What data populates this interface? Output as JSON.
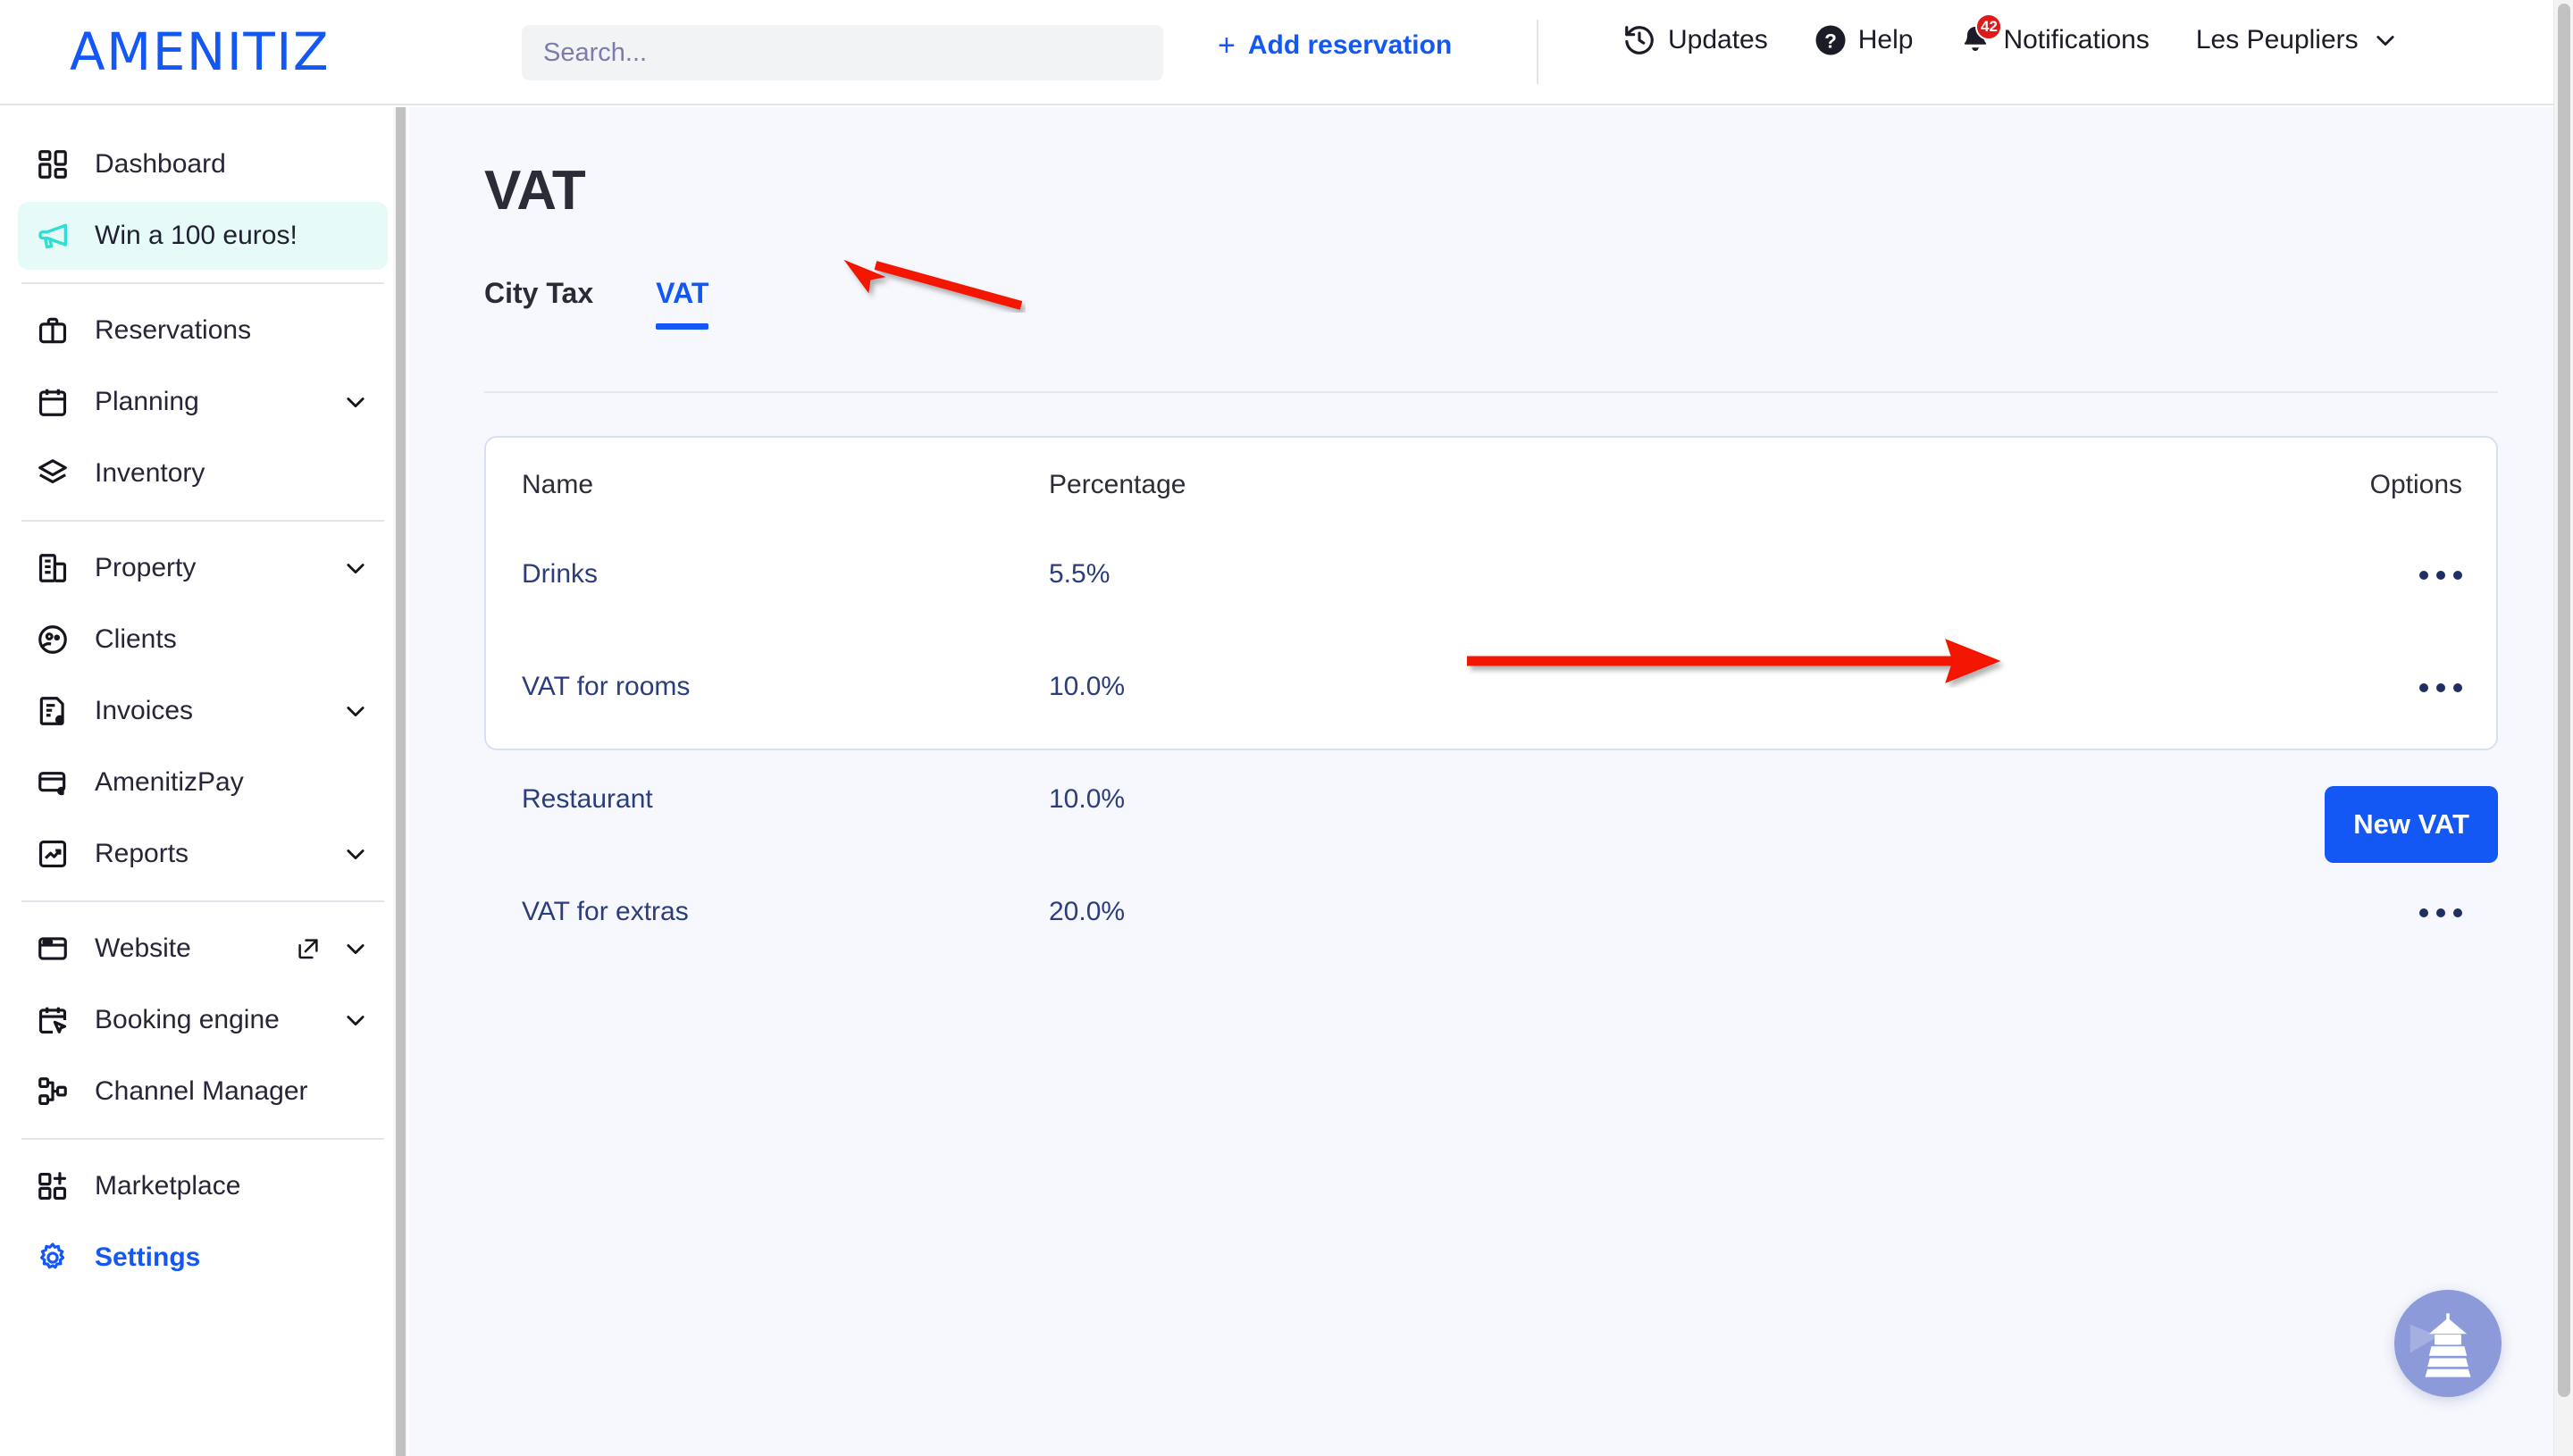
{
  "header": {
    "brand": "AMENITIZ",
    "search_placeholder": "Search...",
    "add_reservation": "Add reservation",
    "add_plus": "+",
    "updates": "Updates",
    "help": "Help",
    "notifications": "Notifications",
    "notification_count": "42",
    "property_name": "Les Peupliers",
    "chevron": "⌄"
  },
  "sidebar": {
    "items": [
      {
        "label": "Dashboard",
        "icon": "dashboard-icon",
        "chevron": false,
        "external": false
      },
      {
        "label": "Win a 100 euros!",
        "icon": "megaphone-icon",
        "chevron": false,
        "external": false
      },
      {
        "label": "Reservations",
        "icon": "briefcase-icon",
        "chevron": false,
        "external": false
      },
      {
        "label": "Planning",
        "icon": "calendar-icon",
        "chevron": true,
        "external": false
      },
      {
        "label": "Inventory",
        "icon": "layers-icon",
        "chevron": false,
        "external": false
      },
      {
        "label": "Property",
        "icon": "building-icon",
        "chevron": true,
        "external": false
      },
      {
        "label": "Clients",
        "icon": "clients-icon",
        "chevron": false,
        "external": false
      },
      {
        "label": "Invoices",
        "icon": "invoice-euro-icon",
        "chevron": true,
        "external": false
      },
      {
        "label": "AmenitizPay",
        "icon": "card-euro-icon",
        "chevron": false,
        "external": false
      },
      {
        "label": "Reports",
        "icon": "chart-up-icon",
        "chevron": true,
        "external": false
      },
      {
        "label": "Website",
        "icon": "browser-icon",
        "chevron": true,
        "external": true
      },
      {
        "label": "Booking engine",
        "icon": "calendar-click-icon",
        "chevron": true,
        "external": false
      },
      {
        "label": "Channel Manager",
        "icon": "nodes-icon",
        "chevron": false,
        "external": false
      },
      {
        "label": "Marketplace",
        "icon": "grid-plus-icon",
        "chevron": false,
        "external": false
      },
      {
        "label": "Settings",
        "icon": "gear-icon",
        "chevron": false,
        "external": false
      }
    ]
  },
  "main": {
    "title": "VAT",
    "tabs": [
      {
        "label": "City Tax",
        "active": false
      },
      {
        "label": "VAT",
        "active": true
      }
    ],
    "table": {
      "columns": [
        "Name",
        "Percentage",
        "Options"
      ],
      "rows": [
        {
          "name": "Drinks",
          "percentage": "5.5%"
        },
        {
          "name": "VAT for rooms",
          "percentage": "10.0%"
        },
        {
          "name": "Restaurant",
          "percentage": "10.0%"
        },
        {
          "name": "VAT for extras",
          "percentage": "20.0%"
        }
      ]
    },
    "new_button": "New VAT"
  },
  "fab": {
    "icon": "lighthouse-icon"
  },
  "colors": {
    "brand_blue": "#1358f5",
    "page_bg": "#f6f8fd",
    "promo_bg": "#e6fbf7",
    "promo_icon": "#2fded0",
    "row_text": "#2b3d7b",
    "annotation_red": "#f31200",
    "fab_bg": "#8c9ad9",
    "badge_red": "#e01919"
  }
}
